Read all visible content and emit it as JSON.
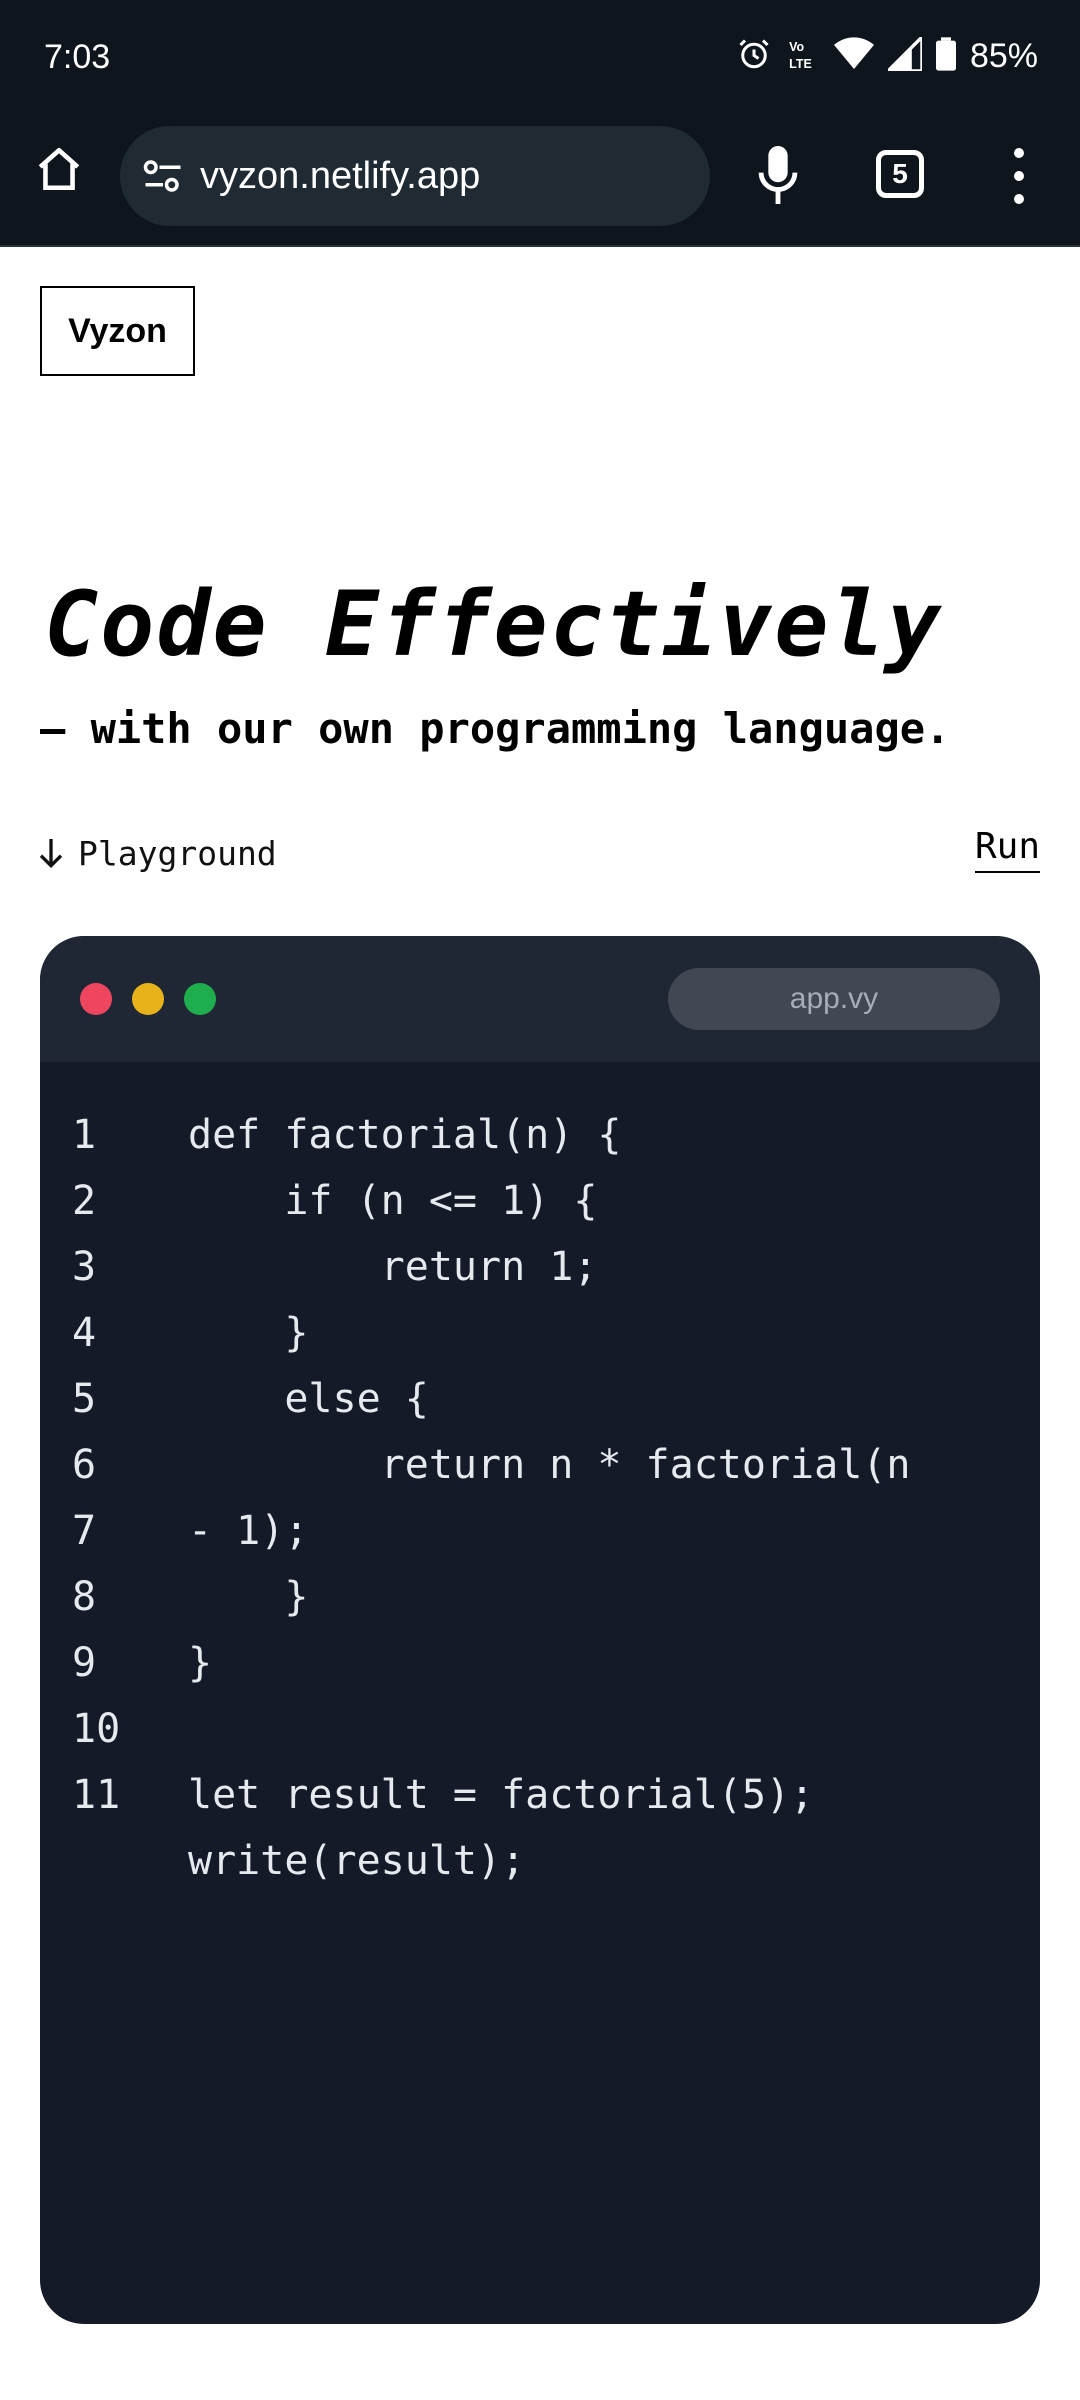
{
  "status_bar": {
    "time": "7:03",
    "battery": "85%",
    "icons": [
      "alarm-icon",
      "volte-icon",
      "wifi-icon",
      "signal-icon",
      "battery-icon"
    ]
  },
  "browser": {
    "url": "vyzon.netlify.app",
    "tab_count": "5",
    "icons": [
      "home-icon",
      "site-info-icon",
      "microphone-icon",
      "tabs-icon",
      "more-menu-icon"
    ]
  },
  "page": {
    "logo": "Vyzon",
    "title": "Code Effectively",
    "subtitle": "— with our own programming language.",
    "playground_label": "Playground",
    "run_label": "Run"
  },
  "editor": {
    "filename": "app.vy",
    "colors": {
      "background": "#141a28",
      "bar": "#1f2735",
      "red": "#ef4660",
      "yellow": "#e8b21a",
      "green": "#1fae4e"
    },
    "lines": [
      {
        "num": "1",
        "text": "def factorial(n) {"
      },
      {
        "num": "2",
        "text": "    if (n <= 1) {"
      },
      {
        "num": "3",
        "text": "        return 1;"
      },
      {
        "num": "4",
        "text": "    }"
      },
      {
        "num": "5",
        "text": "    else {"
      },
      {
        "num": "6",
        "text": "        return n * factorial(n"
      },
      {
        "num": "7",
        "text": "- 1);"
      },
      {
        "num": "8",
        "text": "    }"
      },
      {
        "num": "9",
        "text": "}"
      },
      {
        "num": "10",
        "text": ""
      },
      {
        "num": "11",
        "text": "let result = factorial(5);"
      },
      {
        "num": "",
        "text": "write(result);"
      }
    ]
  }
}
